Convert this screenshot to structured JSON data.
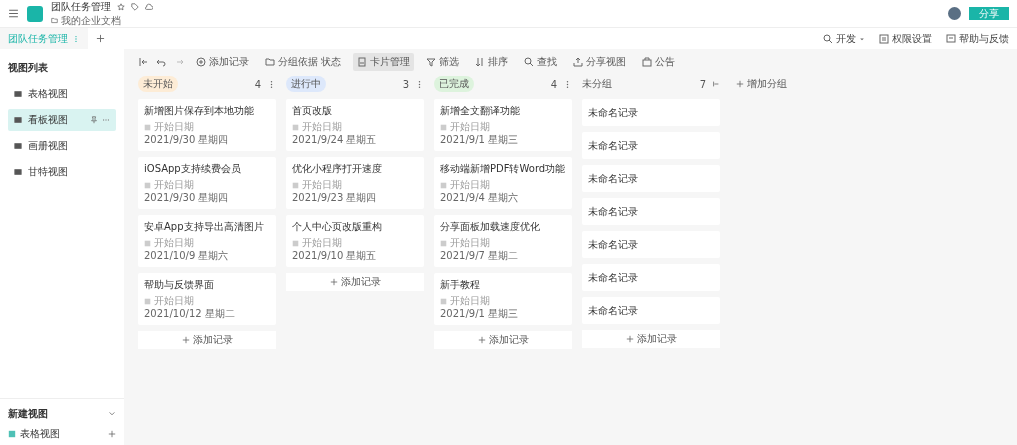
{
  "header": {
    "title": "团队任务管理",
    "breadcrumb": "我的企业文档",
    "share_button": "分享"
  },
  "tabs": [
    {
      "label": "团队任务管理",
      "selected": true
    }
  ],
  "tab_actions": [
    "开发",
    "权限设置",
    "帮助与反馈"
  ],
  "sidebar": {
    "title": "视图列表",
    "items": [
      {
        "label": "表格视图",
        "selected": false
      },
      {
        "label": "看板视图",
        "selected": true
      },
      {
        "label": "画册视图",
        "selected": false
      },
      {
        "label": "甘特视图",
        "selected": false
      }
    ],
    "new_view_title": "新建视图",
    "new_view_items": [
      "表格视图"
    ]
  },
  "toolbar": [
    {
      "kind": "add",
      "label": "添加记录",
      "selected": false
    },
    {
      "kind": "group",
      "label": "分组依据 状态",
      "selected": false
    },
    {
      "kind": "card",
      "label": "卡片管理",
      "selected": true
    },
    {
      "kind": "filter",
      "label": "筛选",
      "selected": false
    },
    {
      "kind": "sort",
      "label": "排序",
      "selected": false
    },
    {
      "kind": "search",
      "label": "查找",
      "selected": false
    },
    {
      "kind": "share",
      "label": "分享视图",
      "selected": false
    },
    {
      "kind": "notice",
      "label": "公告",
      "selected": false
    }
  ],
  "columns": [
    {
      "name": "未开始",
      "color": "#fdecd6",
      "count": "4",
      "add_label": "添加记录",
      "cards": [
        {
          "title": "新增图片保存到本地功能",
          "field": "开始日期",
          "date": "2021/9/30 星期四"
        },
        {
          "title": "iOSApp支持续费会员",
          "field": "开始日期",
          "date": "2021/9/30 星期四"
        },
        {
          "title": "安卓App支持导出高清图片",
          "field": "开始日期",
          "date": "2021/10/9 星期六"
        },
        {
          "title": "帮助与反馈界面",
          "field": "开始日期",
          "date": "2021/10/12 星期二"
        }
      ]
    },
    {
      "name": "进行中",
      "color": "#dde8fb",
      "count": "3",
      "add_label": "添加记录",
      "cards": [
        {
          "title": "首页改版",
          "field": "开始日期",
          "date": "2021/9/24 星期五"
        },
        {
          "title": "优化小程序打开速度",
          "field": "开始日期",
          "date": "2021/9/23 星期四"
        },
        {
          "title": "个人中心页改版重构",
          "field": "开始日期",
          "date": "2021/9/10 星期五"
        }
      ]
    },
    {
      "name": "已完成",
      "color": "#ddf3dd",
      "count": "4",
      "add_label": "添加记录",
      "cards": [
        {
          "title": "新增全文翻译功能",
          "field": "开始日期",
          "date": "2021/9/1 星期三"
        },
        {
          "title": "移动端新增PDF转Word功能",
          "field": "开始日期",
          "date": "2021/9/4 星期六"
        },
        {
          "title": "分享面板加载速度优化",
          "field": "开始日期",
          "date": "2021/9/7 星期二"
        },
        {
          "title": "新手教程",
          "field": "开始日期",
          "date": "2021/9/1 星期三"
        }
      ]
    },
    {
      "name": "未分组",
      "count": "7",
      "add_label": "添加记录",
      "cards": [
        {
          "title": "未命名记录"
        },
        {
          "title": "未命名记录"
        },
        {
          "title": "未命名记录"
        },
        {
          "title": "未命名记录"
        },
        {
          "title": "未命名记录"
        },
        {
          "title": "未命名记录"
        },
        {
          "title": "未命名记录"
        }
      ]
    }
  ],
  "add_group": "增加分组"
}
